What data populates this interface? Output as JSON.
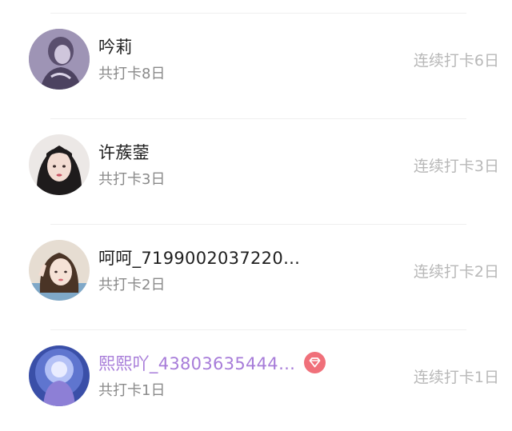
{
  "colors": {
    "name": "#1f1f1f",
    "vip_name": "#a77cd9",
    "secondary": "#8a8a8a",
    "streak": "#b8b8b8",
    "badge": "#f0707a"
  },
  "users": [
    {
      "name": "吟莉",
      "total": "共打卡8日",
      "streak": "连续打卡6日",
      "avatar_icon": "avatar-photo-icon",
      "vip": false
    },
    {
      "name": "许蔟蓥",
      "total": "共打卡3日",
      "streak": "连续打卡3日",
      "avatar_icon": "avatar-photo-icon",
      "vip": false
    },
    {
      "name": "呵呵_7199002037220…",
      "total": "共打卡2日",
      "streak": "连续打卡2日",
      "avatar_icon": "avatar-photo-icon",
      "vip": false
    },
    {
      "name": "熙熙吖_43803635444…",
      "total": "共打卡1日",
      "streak": "连续打卡1日",
      "avatar_icon": "avatar-photo-icon",
      "vip": true,
      "badge_icon": "diamond-badge-icon"
    }
  ]
}
